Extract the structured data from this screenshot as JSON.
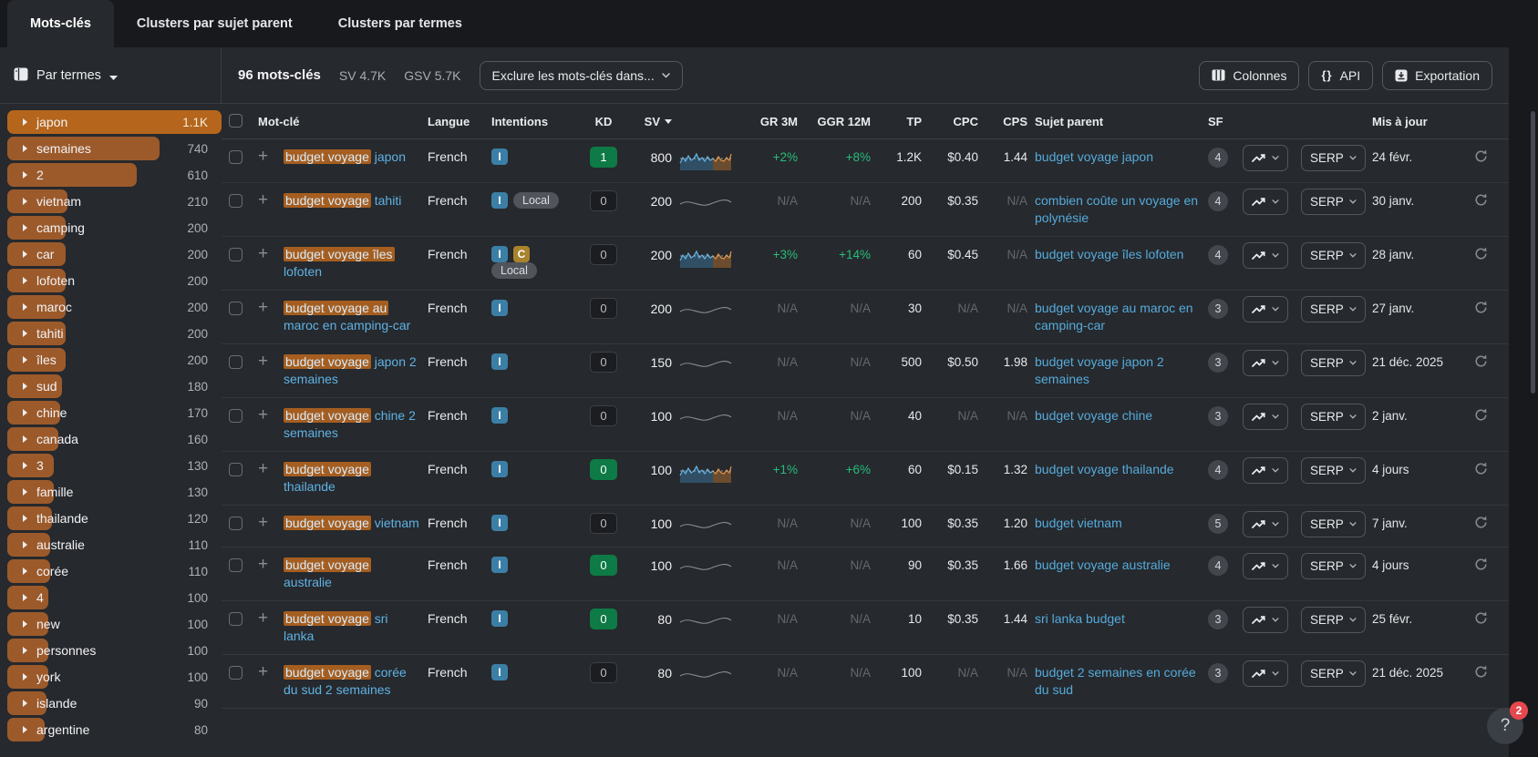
{
  "tabs": [
    {
      "label": "Mots-clés",
      "active": true
    },
    {
      "label": "Clusters par sujet parent",
      "active": false
    },
    {
      "label": "Clusters par termes",
      "active": false
    }
  ],
  "toolbar": {
    "view_selector": "Par termes",
    "keywords_count": "96 mots-clés",
    "sv_stat": "SV 4.7K",
    "gsv_stat": "GSV 5.7K",
    "exclude_button": "Exclure les mots-clés dans...",
    "columns_button": "Colonnes",
    "api_button": "API",
    "api_glyph": "{}",
    "export_button": "Exportation"
  },
  "sidebar_terms": [
    {
      "label": "japon",
      "count": "1.1K",
      "value": 1100,
      "selected": true
    },
    {
      "label": "semaines",
      "count": "740",
      "value": 740,
      "selected": false
    },
    {
      "label": "2",
      "count": "610",
      "value": 610,
      "selected": false
    },
    {
      "label": "vietnam",
      "count": "210",
      "value": 210,
      "selected": false
    },
    {
      "label": "camping",
      "count": "200",
      "value": 200,
      "selected": false
    },
    {
      "label": "car",
      "count": "200",
      "value": 200,
      "selected": false
    },
    {
      "label": "lofoten",
      "count": "200",
      "value": 200,
      "selected": false
    },
    {
      "label": "maroc",
      "count": "200",
      "value": 200,
      "selected": false
    },
    {
      "label": "tahiti",
      "count": "200",
      "value": 200,
      "selected": false
    },
    {
      "label": "îles",
      "count": "200",
      "value": 200,
      "selected": false
    },
    {
      "label": "sud",
      "count": "180",
      "value": 180,
      "selected": false
    },
    {
      "label": "chine",
      "count": "170",
      "value": 170,
      "selected": false
    },
    {
      "label": "canada",
      "count": "160",
      "value": 160,
      "selected": false
    },
    {
      "label": "3",
      "count": "130",
      "value": 130,
      "selected": false
    },
    {
      "label": "famille",
      "count": "130",
      "value": 130,
      "selected": false
    },
    {
      "label": "thailande",
      "count": "120",
      "value": 120,
      "selected": false
    },
    {
      "label": "australie",
      "count": "110",
      "value": 110,
      "selected": false
    },
    {
      "label": "corée",
      "count": "110",
      "value": 110,
      "selected": false
    },
    {
      "label": "4",
      "count": "100",
      "value": 100,
      "selected": false
    },
    {
      "label": "new",
      "count": "100",
      "value": 100,
      "selected": false
    },
    {
      "label": "personnes",
      "count": "100",
      "value": 100,
      "selected": false
    },
    {
      "label": "york",
      "count": "100",
      "value": 100,
      "selected": false
    },
    {
      "label": "islande",
      "count": "90",
      "value": 90,
      "selected": false
    },
    {
      "label": "argentine",
      "count": "80",
      "value": 80,
      "selected": false
    }
  ],
  "table": {
    "headers": {
      "keyword": "Mot-clé",
      "language": "Langue",
      "intents": "Intentions",
      "kd": "KD",
      "sv": "SV",
      "gr3m": "GR 3M",
      "ggr12m": "GGR 12M",
      "tp": "TP",
      "cpc": "CPC",
      "cps": "CPS",
      "parent": "Sujet parent",
      "sf": "SF",
      "updated": "Mis à jour"
    },
    "serp_button": "SERP",
    "rows": [
      {
        "hl": "budget voyage",
        "rest": "japon",
        "lang": "French",
        "intents": [
          {
            "label": "I",
            "type": "i"
          }
        ],
        "kd": "1",
        "kd_style": "green",
        "sv": "800",
        "trend": "volatile",
        "gr3m": "+2%",
        "ggr12m": "+8%",
        "tp": "1.2K",
        "cpc": "$0.40",
        "cps": "1.44",
        "parent": "budget voyage japon",
        "sf": "4",
        "updated": "24 févr."
      },
      {
        "hl": "budget voyage",
        "rest": "tahiti",
        "lang": "French",
        "intents": [
          {
            "label": "I",
            "type": "i"
          },
          {
            "label": "Local",
            "type": "pill"
          }
        ],
        "kd": "0",
        "kd_style": "dark",
        "sv": "200",
        "trend": "flat",
        "gr3m": "N/A",
        "ggr12m": "N/A",
        "tp": "200",
        "cpc": "$0.35",
        "cps": "N/A",
        "parent": "combien coûte un voyage en polynésie",
        "sf": "4",
        "updated": "30 janv."
      },
      {
        "hl": "budget voyage îles",
        "rest": "lofoten",
        "lang": "French",
        "intents": [
          {
            "label": "I",
            "type": "i"
          },
          {
            "label": "C",
            "type": "c"
          },
          {
            "label": "Local",
            "type": "pill"
          }
        ],
        "kd": "0",
        "kd_style": "dark",
        "sv": "200",
        "trend": "volatile",
        "gr3m": "+3%",
        "ggr12m": "+14%",
        "tp": "60",
        "cpc": "$0.45",
        "cps": "N/A",
        "parent": "budget voyage îles lofoten",
        "sf": "4",
        "updated": "28 janv."
      },
      {
        "hl": "budget voyage au",
        "rest": "maroc en camping-car",
        "lang": "French",
        "intents": [
          {
            "label": "I",
            "type": "i"
          }
        ],
        "kd": "0",
        "kd_style": "dark",
        "sv": "200",
        "trend": "flat",
        "gr3m": "N/A",
        "ggr12m": "N/A",
        "tp": "30",
        "cpc": "N/A",
        "cps": "N/A",
        "parent": "budget voyage au maroc en camping-car",
        "sf": "3",
        "updated": "27 janv."
      },
      {
        "hl": "budget voyage",
        "rest": "japon 2 semaines",
        "lang": "French",
        "intents": [
          {
            "label": "I",
            "type": "i"
          }
        ],
        "kd": "0",
        "kd_style": "dark",
        "sv": "150",
        "trend": "flat",
        "gr3m": "N/A",
        "ggr12m": "N/A",
        "tp": "500",
        "cpc": "$0.50",
        "cps": "1.98",
        "parent": "budget voyage japon 2 semaines",
        "sf": "3",
        "updated": "21 déc. 2025"
      },
      {
        "hl": "budget voyage",
        "rest": "chine 2 semaines",
        "lang": "French",
        "intents": [
          {
            "label": "I",
            "type": "i"
          }
        ],
        "kd": "0",
        "kd_style": "dark",
        "sv": "100",
        "trend": "flat",
        "gr3m": "N/A",
        "ggr12m": "N/A",
        "tp": "40",
        "cpc": "N/A",
        "cps": "N/A",
        "parent": "budget voyage chine",
        "sf": "3",
        "updated": "2 janv."
      },
      {
        "hl": "budget voyage",
        "rest": "thailande",
        "lang": "French",
        "intents": [
          {
            "label": "I",
            "type": "i"
          }
        ],
        "kd": "0",
        "kd_style": "green",
        "sv": "100",
        "trend": "volatile",
        "gr3m": "+1%",
        "ggr12m": "+6%",
        "tp": "60",
        "cpc": "$0.15",
        "cps": "1.32",
        "parent": "budget voyage thailande",
        "sf": "4",
        "updated": "4 jours"
      },
      {
        "hl": "budget voyage",
        "rest": "vietnam",
        "lang": "French",
        "intents": [
          {
            "label": "I",
            "type": "i"
          }
        ],
        "kd": "0",
        "kd_style": "dark",
        "sv": "100",
        "trend": "flat",
        "gr3m": "N/A",
        "ggr12m": "N/A",
        "tp": "100",
        "cpc": "$0.35",
        "cps": "1.20",
        "parent": "budget vietnam",
        "sf": "5",
        "updated": "7 janv."
      },
      {
        "hl": "budget voyage",
        "rest": "australie",
        "lang": "French",
        "intents": [
          {
            "label": "I",
            "type": "i"
          }
        ],
        "kd": "0",
        "kd_style": "green",
        "sv": "100",
        "trend": "flat",
        "gr3m": "N/A",
        "ggr12m": "N/A",
        "tp": "90",
        "cpc": "$0.35",
        "cps": "1.66",
        "parent": "budget voyage australie",
        "sf": "4",
        "updated": "4 jours"
      },
      {
        "hl": "budget voyage",
        "rest": "sri lanka",
        "lang": "French",
        "intents": [
          {
            "label": "I",
            "type": "i"
          }
        ],
        "kd": "0",
        "kd_style": "green",
        "sv": "80",
        "trend": "flat",
        "gr3m": "N/A",
        "ggr12m": "N/A",
        "tp": "10",
        "cpc": "$0.35",
        "cps": "1.44",
        "parent": "sri lanka budget",
        "sf": "3",
        "updated": "25 févr."
      },
      {
        "hl": "budget voyage",
        "rest": "corée du sud 2 semaines",
        "lang": "French",
        "intents": [
          {
            "label": "I",
            "type": "i"
          }
        ],
        "kd": "0",
        "kd_style": "dark",
        "sv": "80",
        "trend": "flat",
        "gr3m": "N/A",
        "ggr12m": "N/A",
        "tp": "100",
        "cpc": "N/A",
        "cps": "N/A",
        "parent": "budget 2 semaines en corée du sud",
        "sf": "3",
        "updated": "21 déc. 2025"
      }
    ]
  },
  "help": {
    "label": "?",
    "notification_count": "2"
  },
  "colors": {
    "background": "#26292d",
    "frame": "#17191c",
    "highlight_orange": "#a55e20",
    "selected_orange": "#b5661c",
    "link_blue": "#58aede",
    "positive_green": "#27bd7c",
    "kd_green": "#0e7a45",
    "intent_blue": "#3c7fa6",
    "intent_gold": "#a8832d",
    "badge_red": "#e5484d"
  }
}
